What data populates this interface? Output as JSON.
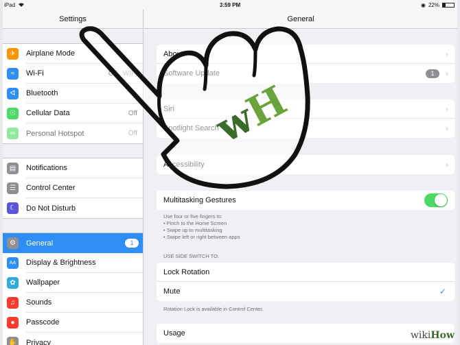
{
  "status": {
    "device": "iPad",
    "time": "3:59 PM",
    "battery": "22%",
    "battery_level": 0.22
  },
  "left": {
    "title": "Settings",
    "group1": [
      {
        "label": "Airplane Mode",
        "icon": "airplane-icon",
        "color": "#ff9500",
        "value": ""
      },
      {
        "label": "Wi-Fi",
        "icon": "wifi-icon",
        "color": "#2e8ef6",
        "value": "OT...WIFI"
      },
      {
        "label": "Bluetooth",
        "icon": "bluetooth-icon",
        "color": "#2e8ef6",
        "value": ""
      },
      {
        "label": "Cellular Data",
        "icon": "cellular-icon",
        "color": "#4cd964",
        "value": "Off"
      },
      {
        "label": "Personal Hotspot",
        "icon": "hotspot-icon",
        "color": "#4cd964",
        "value": "Off"
      }
    ],
    "group2": [
      {
        "label": "Notifications",
        "icon": "notifications-icon",
        "color": "#8e8e93"
      },
      {
        "label": "Control Center",
        "icon": "control-center-icon",
        "color": "#8e8e93"
      },
      {
        "label": "Do Not Disturb",
        "icon": "moon-icon",
        "color": "#5856d6"
      }
    ],
    "group3": [
      {
        "label": "General",
        "icon": "gear-icon",
        "color": "#8e8e93",
        "badge": "1"
      },
      {
        "label": "Display & Brightness",
        "icon": "display-icon",
        "color": "#2e8ef6"
      },
      {
        "label": "Wallpaper",
        "icon": "wallpaper-icon",
        "color": "#34aadc"
      },
      {
        "label": "Sounds",
        "icon": "sounds-icon",
        "color": "#ff3b30"
      },
      {
        "label": "Passcode",
        "icon": "lock-icon",
        "color": "#ff3b30"
      },
      {
        "label": "Privacy",
        "icon": "hand-icon",
        "color": "#8e8e93"
      }
    ]
  },
  "right": {
    "title": "General",
    "group1": [
      {
        "label": "About"
      },
      {
        "label": "Software Update",
        "badge": "1"
      }
    ],
    "group2": [
      {
        "label": "Siri"
      },
      {
        "label": "Spotlight Search"
      }
    ],
    "group3": [
      {
        "label": "Accessibility"
      }
    ],
    "multitasking": {
      "label": "Multitasking Gestures",
      "note": [
        "Use four or five fingers to:",
        "• Pinch to the Home Screen",
        "• Swipe up to multitasking",
        "• Swipe left or right between apps"
      ]
    },
    "side_switch_header": "USE SIDE SWITCH TO:",
    "side_switch": [
      {
        "label": "Lock Rotation"
      },
      {
        "label": "Mute"
      }
    ],
    "side_switch_caption": "Rotation Lock is available in Control Center.",
    "usage": {
      "label": "Usage"
    }
  },
  "overlay": {
    "logo_text": "wH",
    "watermark_prefix": "wiki",
    "watermark_suffix": "How"
  }
}
